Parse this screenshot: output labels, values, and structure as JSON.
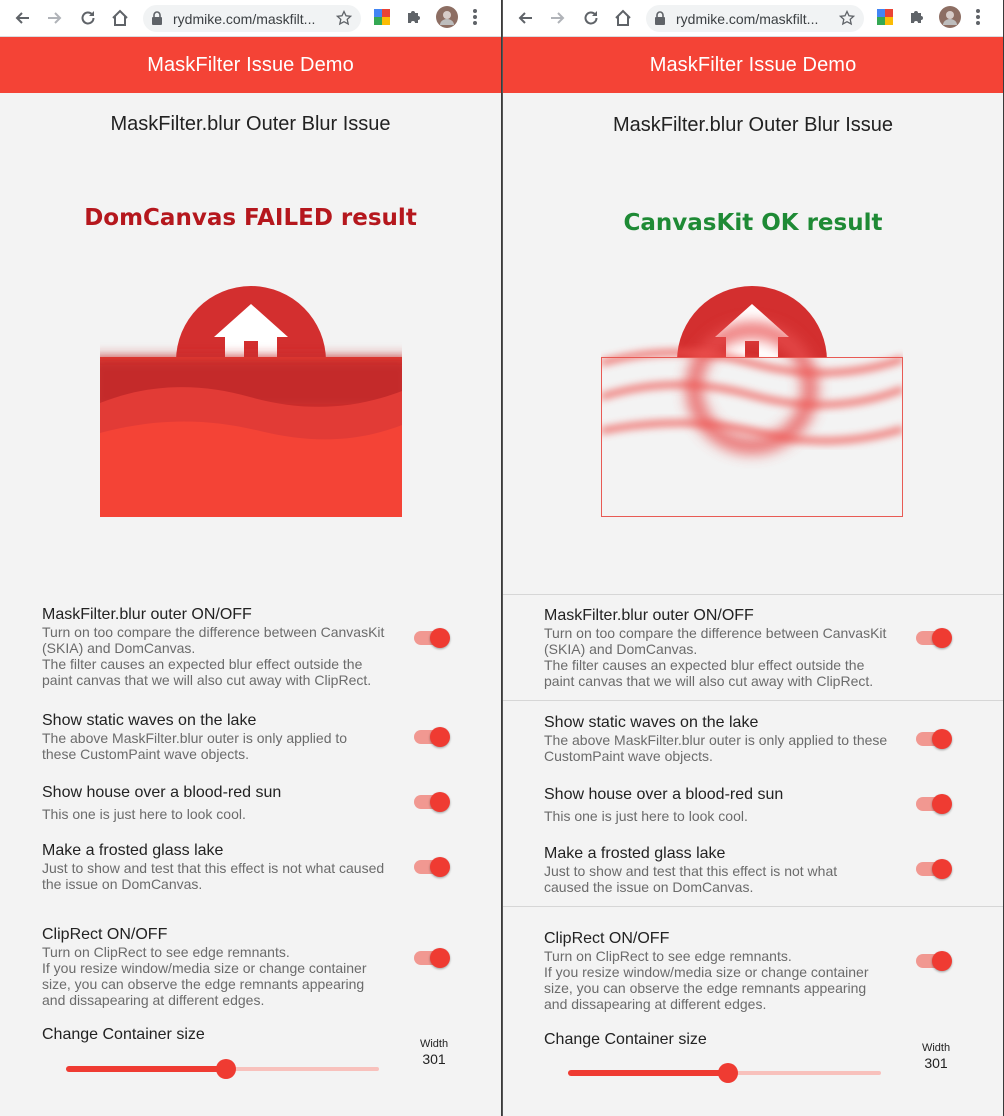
{
  "panes": [
    {
      "id": "left",
      "browser": {
        "url": "rydmike.com/maskfilt..."
      },
      "app_bar_title": "MaskFilter Issue Demo",
      "subtitle": "MaskFilter.blur Outer Blur Issue",
      "result_label": "DomCanvas FAILED result",
      "result_color": "#b5171d",
      "settings": [
        {
          "title": "MaskFilter.blur outer ON/OFF",
          "desc": [
            "Turn on too compare the difference between CanvasKit",
            "(SKIA) and DomCanvas.",
            "The filter causes an expected blur effect outside the",
            "paint canvas that we will also cut away with ClipRect."
          ],
          "on": true
        },
        {
          "title": "Show static waves on the lake",
          "desc": [
            "The above MaskFilter.blur outer is only applied to",
            "these CustomPaint wave objects."
          ],
          "on": true
        },
        {
          "title": "Show house over a blood-red sun",
          "desc": [
            "This one is just here to look cool."
          ],
          "on": true
        },
        {
          "title": "Make a frosted glass lake",
          "desc": [
            "Just to show and test that this effect is not what caused",
            "the issue on DomCanvas."
          ],
          "on": true
        },
        {
          "title": "ClipRect ON/OFF",
          "desc": [
            "Turn on ClipRect to see edge remnants.",
            "If you resize window/media size or change container",
            "size, you can observe the edge remnants appearing",
            "and dissapearing at different edges."
          ],
          "on": true
        }
      ],
      "slider": {
        "label": "Change Container size",
        "value_caption": "Width",
        "value": "301",
        "fraction": 0.51
      }
    },
    {
      "id": "right",
      "browser": {
        "url": "rydmike.com/maskfilt..."
      },
      "app_bar_title": "MaskFilter Issue Demo",
      "subtitle": "MaskFilter.blur Outer Blur Issue",
      "result_label": "CanvasKit OK result",
      "result_color": "#1e8a35",
      "settings": [
        {
          "title": "MaskFilter.blur outer ON/OFF",
          "desc": [
            "Turn on too compare the difference between CanvasKit",
            "(SKIA) and DomCanvas.",
            "The filter causes an expected blur effect outside the",
            "paint canvas that we will also cut away with ClipRect."
          ],
          "on": true
        },
        {
          "title": "Show static waves on the lake",
          "desc": [
            "The above MaskFilter.blur outer is only applied to these",
            "CustomPaint wave objects."
          ],
          "on": true
        },
        {
          "title": "Show house over a blood-red sun",
          "desc": [
            "This one is just here to look cool."
          ],
          "on": true
        },
        {
          "title": "Make a frosted glass lake",
          "desc": [
            "Just to show and test that this effect is not what",
            "caused the issue on DomCanvas."
          ],
          "on": true
        },
        {
          "title": "ClipRect ON/OFF",
          "desc": [
            "Turn on ClipRect to see edge remnants.",
            "If you resize window/media size or change container",
            "size, you can observe the edge remnants appearing",
            "and dissapearing at different edges."
          ],
          "on": true
        }
      ],
      "slider": {
        "label": "Change Container size",
        "value_caption": "Width",
        "value": "301",
        "fraction": 0.51
      }
    }
  ],
  "icons": {
    "toolbar": [
      "back-arrow-icon",
      "forward-arrow-icon",
      "reload-icon",
      "home-icon",
      "lock-icon",
      "bookmark-star-icon",
      "google-extension-icon",
      "extensions-puzzle-icon",
      "profile-avatar-icon",
      "more-menu-icon"
    ],
    "scene": "house-icon"
  },
  "colors": {
    "app_bar": "#f44336",
    "accent": "#ef3b32",
    "sun": "#d32f2f",
    "lake": "#f44336"
  }
}
